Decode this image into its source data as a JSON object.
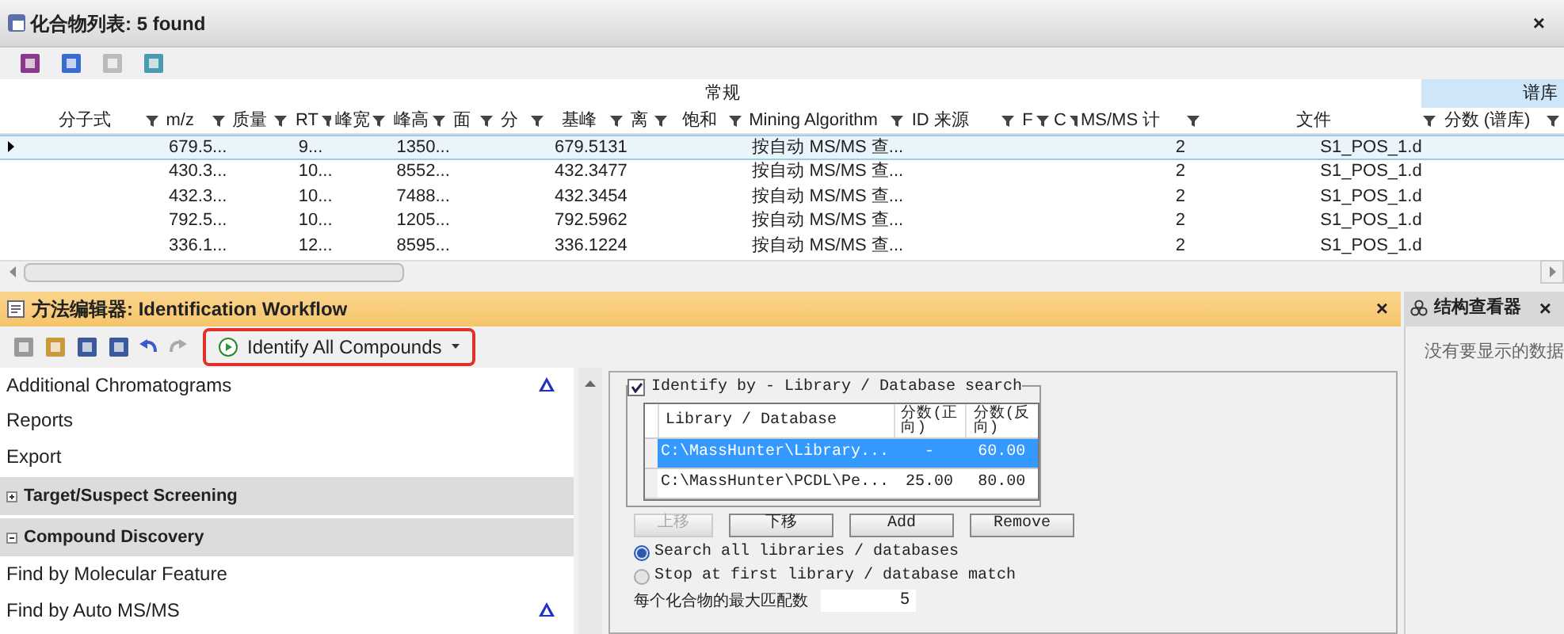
{
  "compound_list": {
    "title": "化合物列表: 5 found",
    "close": "×",
    "column_groups": [
      {
        "label": "常规",
        "kind": "plain"
      },
      {
        "label": "谱库",
        "kind": "highlight"
      }
    ],
    "columns": [
      "分子式",
      "m/z",
      "质量",
      "RT",
      "峰宽",
      "峰高",
      "面",
      "分",
      "基峰",
      "离",
      "饱和",
      "Mining Algorithm",
      "ID 来源",
      "F",
      "C",
      "MS/MS 计",
      "文件",
      "分数 (谱库)"
    ],
    "rows": [
      {
        "selected": true,
        "cells": [
          "",
          "679.5...",
          "",
          "9...",
          "",
          "1350...",
          "",
          "",
          "679.5131",
          "",
          "",
          "按自动 MS/MS 查...",
          "",
          "",
          "",
          "2",
          "S1_POS_1.d",
          ""
        ]
      },
      {
        "selected": false,
        "cells": [
          "",
          "430.3...",
          "",
          "10...",
          "",
          "8552...",
          "",
          "",
          "432.3477",
          "",
          "",
          "按自动 MS/MS 查...",
          "",
          "",
          "",
          "2",
          "S1_POS_1.d",
          ""
        ]
      },
      {
        "selected": false,
        "cells": [
          "",
          "432.3...",
          "",
          "10...",
          "",
          "7488...",
          "",
          "",
          "432.3454",
          "",
          "",
          "按自动 MS/MS 查...",
          "",
          "",
          "",
          "2",
          "S1_POS_1.d",
          ""
        ]
      },
      {
        "selected": false,
        "cells": [
          "",
          "792.5...",
          "",
          "10...",
          "",
          "1205...",
          "",
          "",
          "792.5962",
          "",
          "",
          "按自动 MS/MS 查...",
          "",
          "",
          "",
          "2",
          "S1_POS_1.d",
          ""
        ]
      },
      {
        "selected": false,
        "cells": [
          "",
          "336.1...",
          "",
          "12...",
          "",
          "8595...",
          "",
          "",
          "336.1224",
          "",
          "",
          "按自动 MS/MS 查...",
          "",
          "",
          "",
          "2",
          "S1_POS_1.d",
          ""
        ]
      }
    ]
  },
  "method_editor": {
    "title": "方法编辑器: Identification Workflow",
    "close": "×",
    "run_button": "Identify All Compounds",
    "items": [
      {
        "kind": "item",
        "label": "Additional Chromatograms",
        "flagged": true
      },
      {
        "kind": "item",
        "label": "Reports",
        "flagged": false
      },
      {
        "kind": "item",
        "label": "Export",
        "flagged": false
      },
      {
        "kind": "section",
        "label": "Target/Suspect Screening",
        "expanded": false
      },
      {
        "kind": "section",
        "label": "Compound Discovery",
        "expanded": true
      },
      {
        "kind": "item",
        "label": "Find by Molecular Feature",
        "flagged": false
      },
      {
        "kind": "item",
        "label": "Find by Auto MS/MS",
        "flagged": true
      }
    ],
    "library_search": {
      "label": "Identify by - Library / Database search",
      "checked": true,
      "columns": [
        "Library / Database",
        "分数(正向)",
        "分数(反向)"
      ],
      "rows": [
        {
          "selected": true,
          "cells": [
            "C:\\MassHunter\\Library...",
            "-",
            "60.00"
          ]
        },
        {
          "selected": false,
          "cells": [
            "C:\\MassHunter\\PCDL\\Pe...",
            "25.00",
            "80.00"
          ]
        }
      ],
      "buttons": [
        {
          "label": "上移",
          "disabled": true
        },
        {
          "label": "下移",
          "disabled": false
        },
        {
          "label": "Add",
          "disabled": false
        },
        {
          "label": "Remove",
          "disabled": false
        }
      ],
      "options": [
        {
          "label": "Search all libraries / databases",
          "selected": true
        },
        {
          "label": "Stop at first library / database match",
          "selected": false
        }
      ],
      "max_matches_label": "每个化合物的最大匹配数",
      "max_matches": "5"
    }
  },
  "structure_viewer": {
    "title": "结构查看器",
    "close": "×",
    "empty_text": "没有要显示的数据"
  }
}
